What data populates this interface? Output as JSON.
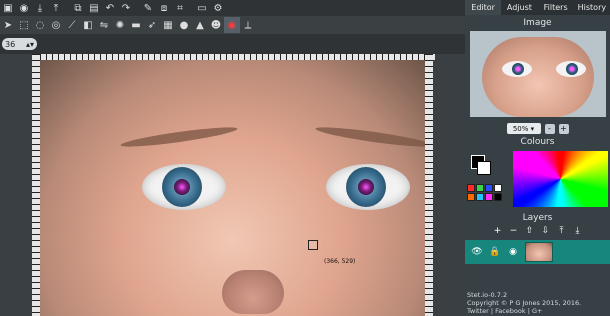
{
  "toolbar_row3": {
    "brush_size": "36"
  },
  "canvas": {
    "coordinates": "(366, 529)"
  },
  "panel": {
    "tabs": [
      "Editor",
      "Adjust",
      "Filters",
      "History"
    ],
    "image_section_title": "Image",
    "zoom_value": "50%",
    "zoom_minus": "-",
    "zoom_plus": "+",
    "colours_section_title": "Colours",
    "layers_section_title": "Layers"
  },
  "footer": {
    "version": "Stet.io-0.7.2",
    "copyright": "Copyright © P G Jones 2015, 2016.",
    "links": "Twitter | Facebook | G+"
  },
  "icons": {
    "row1": [
      "folder-icon",
      "camera-icon",
      "download-icon",
      "upload-icon",
      "copy-icon",
      "paste-icon",
      "undo-icon",
      "redo-icon",
      "pen-icon",
      "duplicate-icon",
      "crop-icon",
      "screen-icon",
      "settings-icon"
    ],
    "row2": [
      "pointer-icon",
      "marquee-icon",
      "lasso-icon",
      "lasso-free-icon",
      "brush-icon",
      "fill-icon",
      "flip-icon",
      "spray-icon",
      "stamp-icon",
      "smudge-icon",
      "gradient-icon",
      "blur-icon",
      "shape-icon",
      "person-icon",
      "red-eye-icon",
      "eyedropper-icon"
    ]
  }
}
